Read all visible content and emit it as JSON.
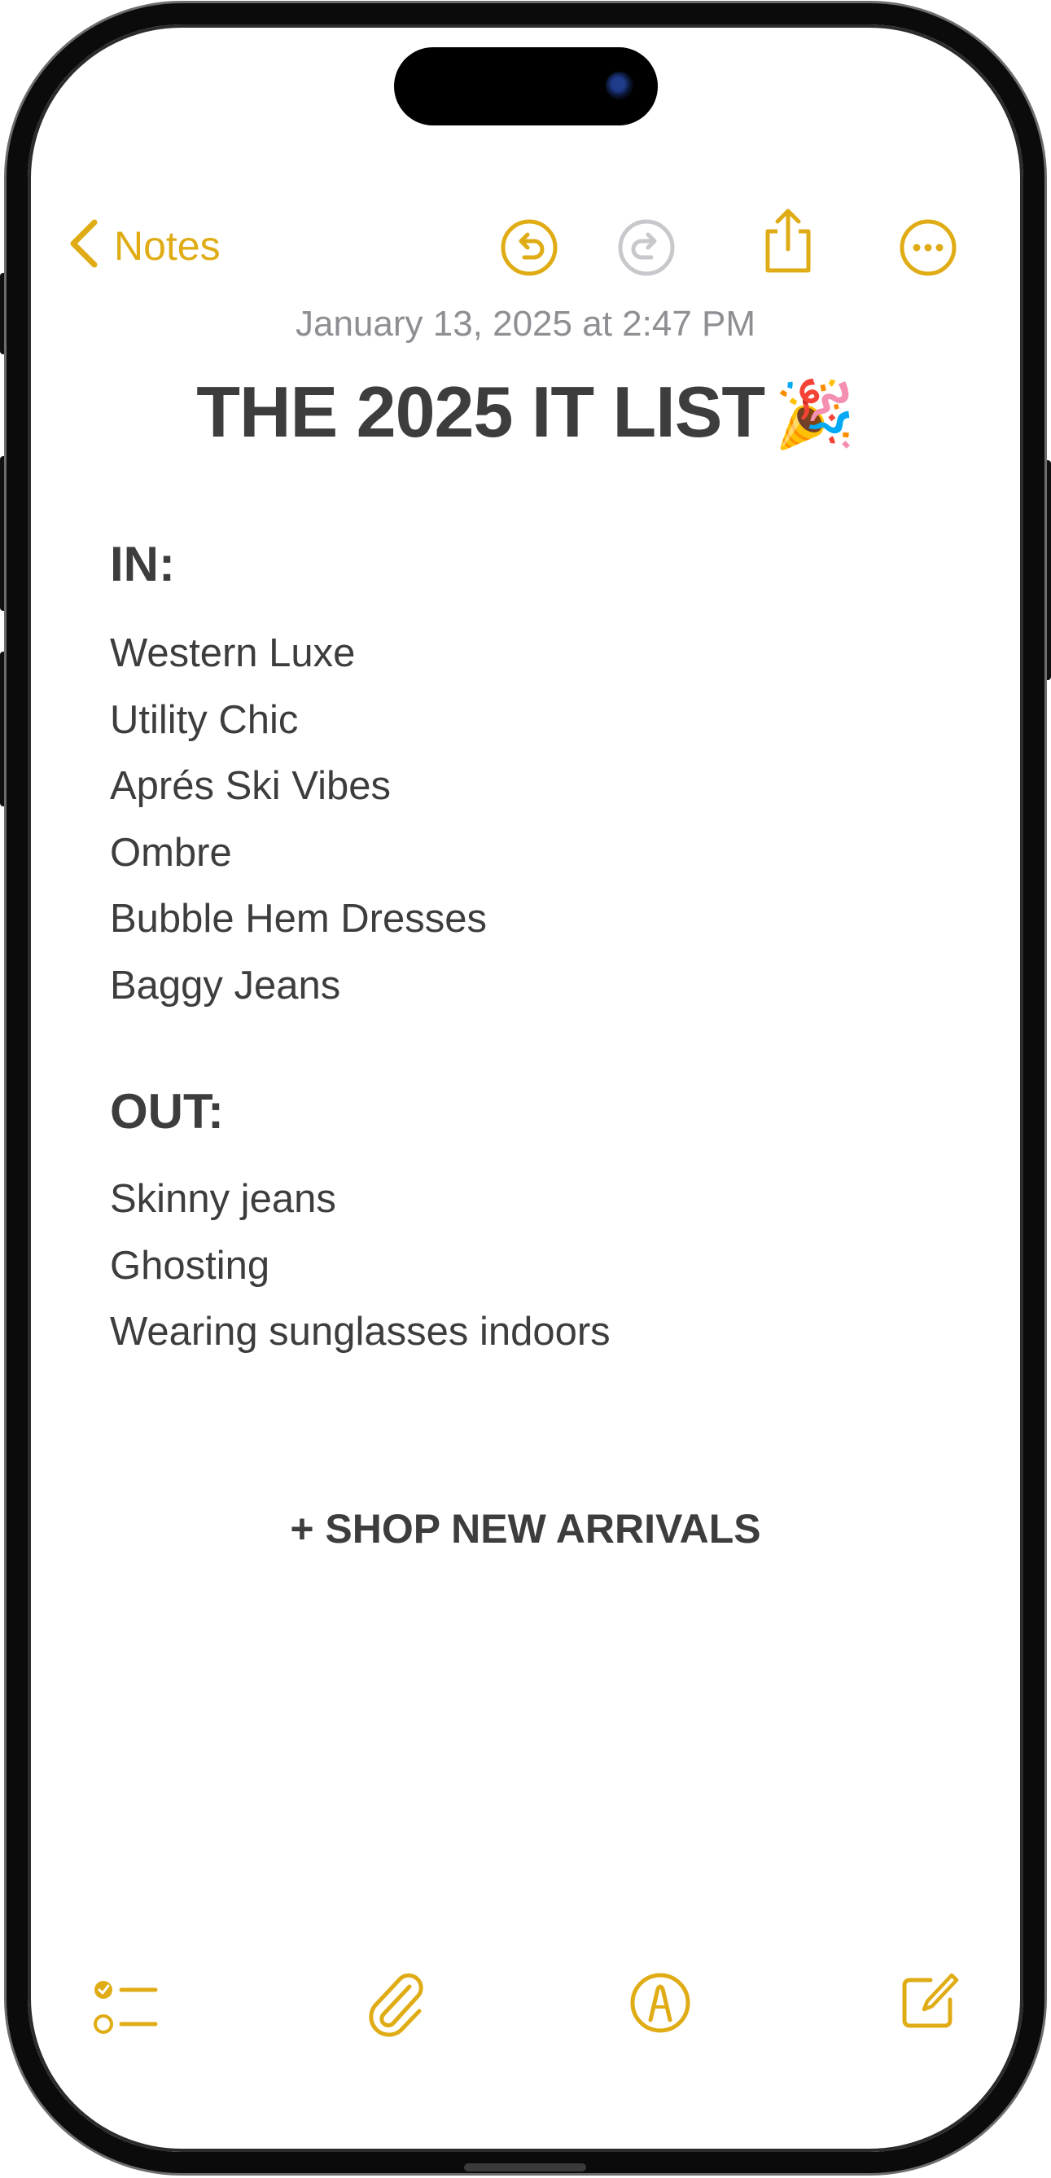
{
  "colors": {
    "accent": "#e0ac16",
    "text": "#3d3d3d",
    "secondary_text": "#8e8e93",
    "disabled_icon": "#c7c7cc"
  },
  "nav": {
    "back_label": "Notes",
    "back_icon": "chevron-left-icon",
    "undo_icon": "undo-icon",
    "redo_icon": "redo-icon",
    "share_icon": "share-icon",
    "more_icon": "more-options-icon"
  },
  "note": {
    "date": "January 13, 2025 at 2:47 PM",
    "title": "THE 2025 IT LIST",
    "title_emoji": "🎉",
    "sections": [
      {
        "heading": "IN:",
        "items": [
          "Western Luxe",
          "Utility Chic",
          "Aprés Ski Vibes",
          "Ombre",
          "Bubble Hem Dresses",
          "Baggy Jeans"
        ]
      },
      {
        "heading": "OUT:",
        "items": [
          "Skinny jeans",
          "Ghosting",
          "Wearing sunglasses indoors"
        ]
      }
    ],
    "cta": "+ SHOP NEW ARRIVALS"
  },
  "toolbar": {
    "checklist_icon": "checklist-icon",
    "attachment_icon": "paperclip-icon",
    "markup_icon": "markup-pen-icon",
    "compose_icon": "compose-icon"
  }
}
